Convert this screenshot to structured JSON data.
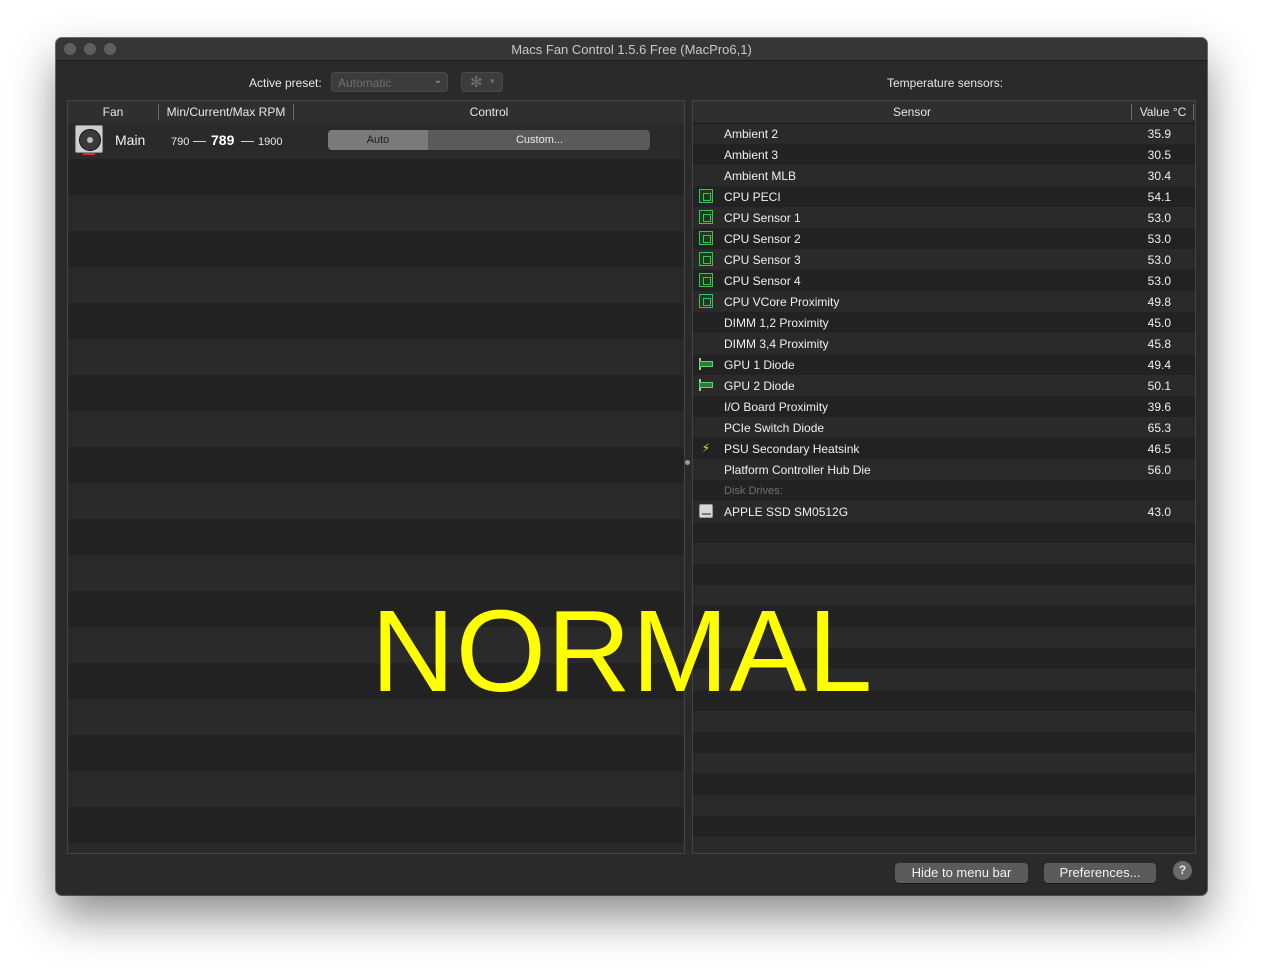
{
  "window": {
    "title": "Macs Fan Control 1.5.6 Free (MacPro6,1)"
  },
  "toolbar": {
    "active_preset_label": "Active preset:",
    "active_preset_value": "Automatic",
    "temperature_sensors_label": "Temperature sensors:"
  },
  "fans_table": {
    "headers": {
      "fan": "Fan",
      "rpm": "Min/Current/Max RPM",
      "control": "Control"
    },
    "rows": [
      {
        "name": "Main",
        "min": "790",
        "current": "789",
        "max": "1900",
        "dash": "—",
        "control_auto": "Auto",
        "control_custom": "Custom..."
      }
    ]
  },
  "sensors_table": {
    "headers": {
      "sensor": "Sensor",
      "value": "Value °C"
    },
    "rows": [
      {
        "name": "Ambient 2",
        "value": "35.9",
        "icon": "none"
      },
      {
        "name": "Ambient 3",
        "value": "30.5",
        "icon": "none"
      },
      {
        "name": "Ambient MLB",
        "value": "30.4",
        "icon": "none"
      },
      {
        "name": "CPU PECI",
        "value": "54.1",
        "icon": "cpu-chip-icon"
      },
      {
        "name": "CPU Sensor 1",
        "value": "53.0",
        "icon": "cpu-chip-icon"
      },
      {
        "name": "CPU Sensor 2",
        "value": "53.0",
        "icon": "cpu-chip-icon"
      },
      {
        "name": "CPU Sensor 3",
        "value": "53.0",
        "icon": "cpu-chip-icon"
      },
      {
        "name": "CPU Sensor 4",
        "value": "53.0",
        "icon": "cpu-chip-icon"
      },
      {
        "name": "CPU VCore Proximity",
        "value": "49.8",
        "icon": "cpu-chip-icon"
      },
      {
        "name": "DIMM 1,2 Proximity",
        "value": "45.0",
        "icon": "none"
      },
      {
        "name": "DIMM 3,4 Proximity",
        "value": "45.8",
        "icon": "none"
      },
      {
        "name": "GPU 1 Diode",
        "value": "49.4",
        "icon": "gpu-card-icon"
      },
      {
        "name": "GPU 2 Diode",
        "value": "50.1",
        "icon": "gpu-card-icon"
      },
      {
        "name": "I/O Board Proximity",
        "value": "39.6",
        "icon": "none"
      },
      {
        "name": "PCIe Switch Diode",
        "value": "65.3",
        "icon": "none"
      },
      {
        "name": "PSU Secondary Heatsink",
        "value": "46.5",
        "icon": "lightning-icon"
      },
      {
        "name": "Platform Controller Hub Die",
        "value": "56.0",
        "icon": "none"
      }
    ],
    "section_disk": "Disk Drives:",
    "disk_rows": [
      {
        "name": "APPLE SSD SM0512G",
        "value": "43.0",
        "icon": "disk-drive-icon"
      }
    ]
  },
  "buttons": {
    "hide_to_menu_bar": "Hide to menu bar",
    "preferences": "Preferences...",
    "help": "?"
  },
  "overlay_text": "NORMAL",
  "colors": {
    "overlay": "#ffff00",
    "window_bg": "#2a2a2a",
    "chip_green": "#3fbf5a",
    "lightning_yellow": "#f6d13b"
  }
}
